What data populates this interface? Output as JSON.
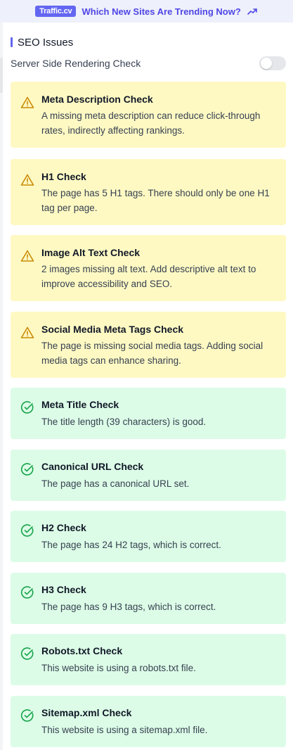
{
  "banner": {
    "brand": "Traffic.cv",
    "link_text": "Which New Sites Are Trending Now?",
    "icon": "trending-up-icon"
  },
  "section": {
    "title": "SEO Issues"
  },
  "ssr": {
    "label": "Server Side Rendering Check",
    "enabled": false
  },
  "colors": {
    "accent": "#6366f1",
    "warning_bg": "#fef9c3",
    "warning_icon": "#ca8a04",
    "success_bg": "#dcfce7",
    "success_icon": "#16a34a"
  },
  "checks": [
    {
      "status": "warning",
      "icon": "warning-icon",
      "title": "Meta Description Check",
      "message": "A missing meta description can reduce click-through rates, indirectly affecting rankings."
    },
    {
      "status": "warning",
      "icon": "warning-icon",
      "title": "H1 Check",
      "message": "The page has 5 H1 tags. There should only be one H1 tag per page."
    },
    {
      "status": "warning",
      "icon": "warning-icon",
      "title": "Image Alt Text Check",
      "message": "2 images missing alt text. Add descriptive alt text to improve accessibility and SEO."
    },
    {
      "status": "warning",
      "icon": "warning-icon",
      "title": "Social Media Meta Tags Check",
      "message": "The page is missing social media tags. Adding social media tags can enhance sharing."
    },
    {
      "status": "ok",
      "icon": "check-circle-icon",
      "title": "Meta Title Check",
      "message": "The title length (39 characters) is good."
    },
    {
      "status": "ok",
      "icon": "check-circle-icon",
      "title": "Canonical URL Check",
      "message": "The page has a canonical URL set."
    },
    {
      "status": "ok",
      "icon": "check-circle-icon",
      "title": "H2 Check",
      "message": "The page has 24 H2 tags, which is correct."
    },
    {
      "status": "ok",
      "icon": "check-circle-icon",
      "title": "H3 Check",
      "message": "The page has 9 H3 tags, which is correct."
    },
    {
      "status": "ok",
      "icon": "check-circle-icon",
      "title": "Robots.txt Check",
      "message": "This website is using a robots.txt file."
    },
    {
      "status": "ok",
      "icon": "check-circle-icon",
      "title": "Sitemap.xml Check",
      "message": "This website is using a sitemap.xml file."
    }
  ]
}
